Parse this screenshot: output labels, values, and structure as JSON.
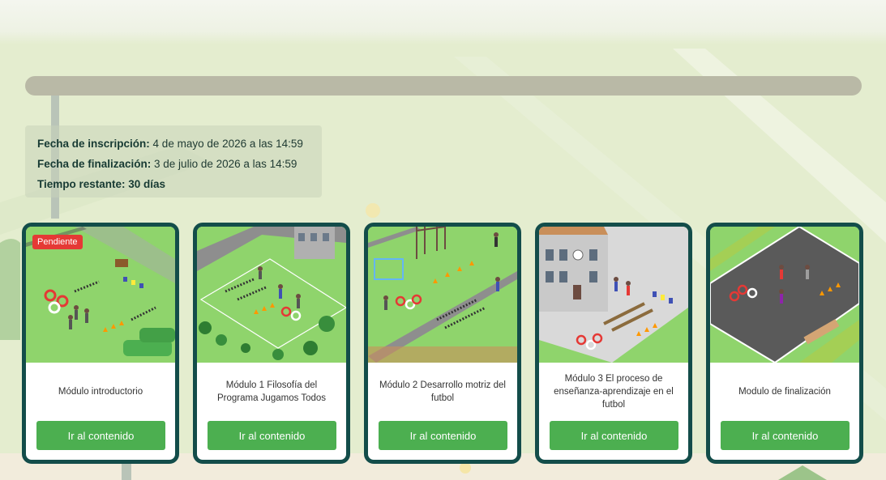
{
  "colors": {
    "background": "#e4edcf",
    "card_border": "#134d4a",
    "button": "#4caf50",
    "badge": "#e53935",
    "progress_track": "#b9b9a6"
  },
  "progress_bar": {
    "value": 0
  },
  "enrollment": {
    "start_label": "Fecha de inscripción:",
    "start_value": " 4 de mayo de 2026 a las 14:59",
    "end_label": "Fecha de finalización:",
    "end_value": " 3 de julio de 2026 a las 14:59",
    "remaining_label": "Tiempo restante: 30 días"
  },
  "modules": [
    {
      "title": "Módulo introductorio",
      "button": "Ir al contenido",
      "badge": "Pendiente"
    },
    {
      "title": "Módulo 1 Filosofía del Programa Jugamos Todos",
      "button": "Ir al contenido"
    },
    {
      "title": "Módulo 2 Desarrollo motriz del futbol",
      "button": "Ir al contenido"
    },
    {
      "title": "Módulo 3 El proceso de enseñanza-aprendizaje en el futbol",
      "button": "Ir al contenido"
    },
    {
      "title": "Modulo de finalización",
      "button": "Ir al contenido"
    }
  ]
}
